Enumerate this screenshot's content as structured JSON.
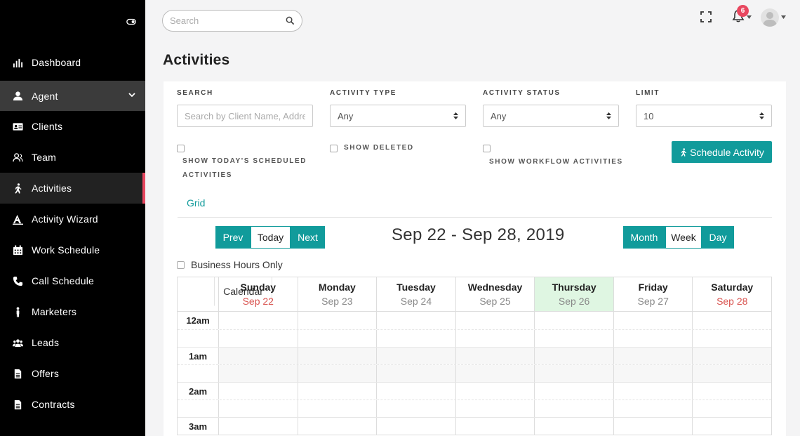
{
  "sidebar": {
    "items": [
      {
        "label": "Dashboard",
        "icon": "bar-chart-icon"
      },
      {
        "label": "Agent",
        "icon": "user-icon"
      },
      {
        "label": "Clients",
        "icon": "id-card-icon"
      },
      {
        "label": "Team",
        "icon": "users-outline-icon"
      },
      {
        "label": "Activities",
        "icon": "walking-icon"
      },
      {
        "label": "Activity Wizard",
        "icon": "wizard-icon"
      },
      {
        "label": "Work Schedule",
        "icon": "calendar-icon"
      },
      {
        "label": "Call Schedule",
        "icon": "phone-icon"
      },
      {
        "label": "Marketers",
        "icon": "person-icon"
      },
      {
        "label": "Leads",
        "icon": "group-icon"
      },
      {
        "label": "Offers",
        "icon": "document-icon"
      },
      {
        "label": "Contracts",
        "icon": "document-icon"
      }
    ],
    "active": "Activities"
  },
  "topbar": {
    "search_placeholder": "Search",
    "notification_count": "6"
  },
  "page": {
    "title": "Activities"
  },
  "filters": {
    "search_label": "SEARCH",
    "search_placeholder": "Search by Client Name, Address",
    "activity_type_label": "ACTIVITY TYPE",
    "activity_type_value": "Any",
    "activity_status_label": "ACTIVITY STATUS",
    "activity_status_value": "Any",
    "limit_label": "LIMIT",
    "limit_value": "10",
    "show_today_line1": "SHOW TODAY'S SCHEDULED",
    "show_today_line2": "ACTIVITIES",
    "show_deleted": "SHOW DELETED",
    "show_workflow": "SHOW WORKFLOW ACTIVITIES",
    "schedule_button": "Schedule Activity"
  },
  "tabs": {
    "grid": "Grid",
    "calendar": "Calendar"
  },
  "calendar": {
    "nav": {
      "prev": "Prev",
      "today": "Today",
      "next": "Next"
    },
    "range_title": "Sep 22 - Sep 28, 2019",
    "views": {
      "month": "Month",
      "week": "Week",
      "day": "Day"
    },
    "business_hours_label": "Business Hours Only",
    "days": [
      {
        "name": "Sunday",
        "date": "Sep 22"
      },
      {
        "name": "Monday",
        "date": "Sep 23"
      },
      {
        "name": "Tuesday",
        "date": "Sep 24"
      },
      {
        "name": "Wednesday",
        "date": "Sep 25"
      },
      {
        "name": "Thursday",
        "date": "Sep 26"
      },
      {
        "name": "Friday",
        "date": "Sep 27"
      },
      {
        "name": "Saturday",
        "date": "Sep 28"
      }
    ],
    "times": [
      "12am",
      "1am",
      "2am",
      "3am"
    ],
    "accent_color": "#119b9b",
    "today_color": "#dff6e2",
    "weekend_date_color": "#d9534f"
  }
}
